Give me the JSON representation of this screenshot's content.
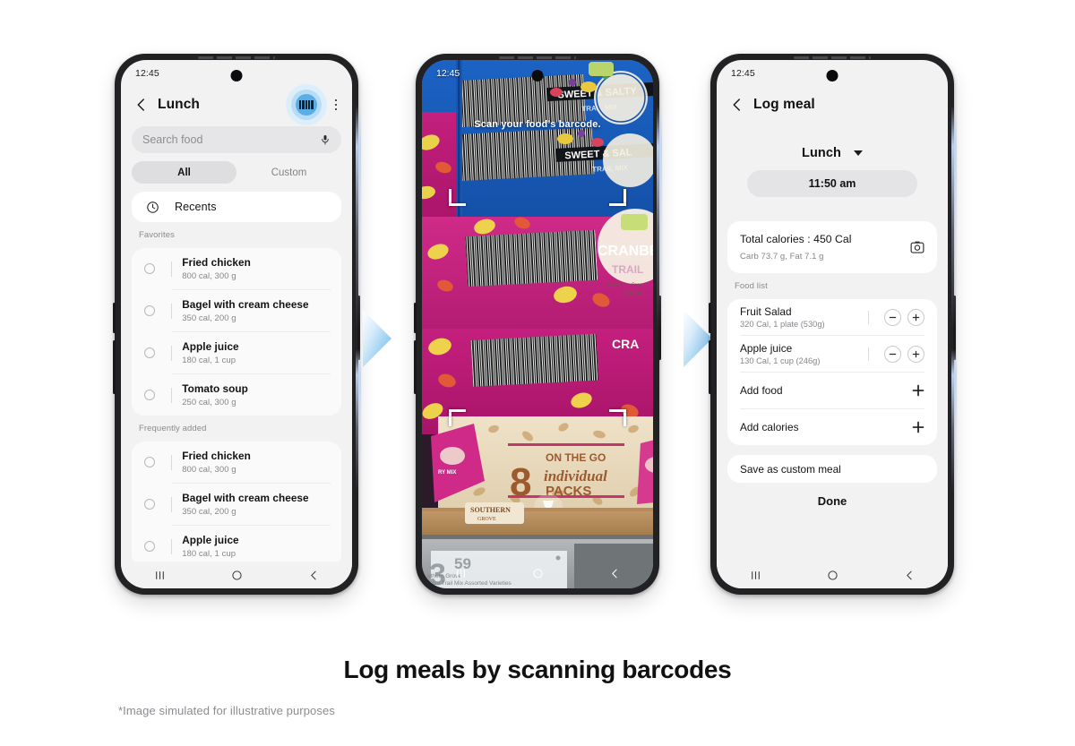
{
  "caption": {
    "headline": "Log meals by scanning barcodes",
    "disclaimer": "*Image simulated for illustrative purposes"
  },
  "colors": {
    "accent_blue": "#5aaee6",
    "halo_mid": "#b7ddf6",
    "halo_outer": "#ddeefb",
    "phone_frame": "#222225",
    "screen_bg": "#f2f2f3",
    "card_bg": "#ffffff",
    "text_primary": "#131315",
    "text_secondary": "#86868c",
    "arrow_blue": "#61b3ea"
  },
  "phone1": {
    "status_time": "12:45",
    "appbar": {
      "back_icon": "chevron-left-icon",
      "title": "Lunch",
      "scan_icon": "barcode-icon",
      "more_icon": "kebab-menu-icon"
    },
    "search": {
      "placeholder": "Search food",
      "mic_icon": "microphone-icon"
    },
    "tabs": [
      {
        "label": "All",
        "active": true
      },
      {
        "label": "Custom",
        "active": false
      }
    ],
    "recents": {
      "icon": "clock-icon",
      "label": "Recents"
    },
    "sections": [
      {
        "label": "Favorites",
        "items": [
          {
            "name": "Fried chicken",
            "detail": "800 cal, 300 g",
            "selected": false
          },
          {
            "name": "Bagel with cream cheese",
            "detail": "350 cal, 200 g",
            "selected": false
          },
          {
            "name": "Apple juice",
            "detail": "180 cal, 1 cup",
            "selected": false
          },
          {
            "name": "Tomato soup",
            "detail": "250 cal, 300 g",
            "selected": false
          }
        ]
      },
      {
        "label": "Frequently added",
        "items": [
          {
            "name": "Fried chicken",
            "detail": "800 cal, 300 g",
            "selected": false
          },
          {
            "name": "Bagel with cream cheese",
            "detail": "350 cal, 200 g",
            "selected": false
          },
          {
            "name": "Apple juice",
            "detail": "180 cal, 1 cup",
            "selected": false
          }
        ]
      }
    ],
    "navbar": {
      "recents_icon": "recent-apps-icon",
      "home_icon": "home-icon",
      "back_icon": "back-icon"
    }
  },
  "phone2": {
    "status_time": "12:45",
    "hint": "Scan your food’s barcode.",
    "viewfinder": "barcode-scan-frame",
    "scene": {
      "product_top": "SWEET & SALTY TRAIL MIX",
      "product_mid": "CRANBERRY TRAIL MIX",
      "product_sub": "Peanuts • Cranberries • Almonds",
      "pack_count": "8",
      "pack_line1": "ON THE GO",
      "pack_line2": "individual",
      "pack_line3": "PACKS",
      "brand_tag": "SOUTHERN GROVE",
      "price": "3",
      "price_cents": "59",
      "shelf_label": "Southern Grove On The Go Trail Mix Assorted Varieties"
    },
    "navbar": {
      "recents_icon": "recent-apps-icon",
      "home_icon": "home-icon",
      "back_icon": "back-icon"
    }
  },
  "phone3": {
    "status_time": "12:45",
    "appbar": {
      "back_icon": "chevron-left-icon",
      "title": "Log meal"
    },
    "meal_type": {
      "value": "Lunch",
      "caret_icon": "chevron-down-icon"
    },
    "time_value": "11:50 am",
    "summary": {
      "total_calories": "Total calories : 450 Cal",
      "macros": "Carb 73.7 g, Fat 7.1 g",
      "camera_icon": "camera-icon"
    },
    "food_list_label": "Food list",
    "food_items": [
      {
        "name": "Fruit Salad",
        "detail": "320 Cal, 1 plate (530g)",
        "minus_icon": "minus-icon",
        "plus_icon": "plus-icon"
      },
      {
        "name": "Apple juice",
        "detail": "130 Cal, 1 cup (246g)",
        "minus_icon": "minus-icon",
        "plus_icon": "plus-icon"
      }
    ],
    "actions": [
      {
        "label": "Add food",
        "icon": "plus-icon"
      },
      {
        "label": "Add calories",
        "icon": "plus-icon"
      }
    ],
    "save_label": "Save as custom meal",
    "done_label": "Done",
    "navbar": {
      "recents_icon": "recent-apps-icon",
      "home_icon": "home-icon",
      "back_icon": "back-icon"
    }
  },
  "arrows": [
    {
      "name": "arrow-step-1-to-2"
    },
    {
      "name": "arrow-step-2-to-3"
    }
  ]
}
